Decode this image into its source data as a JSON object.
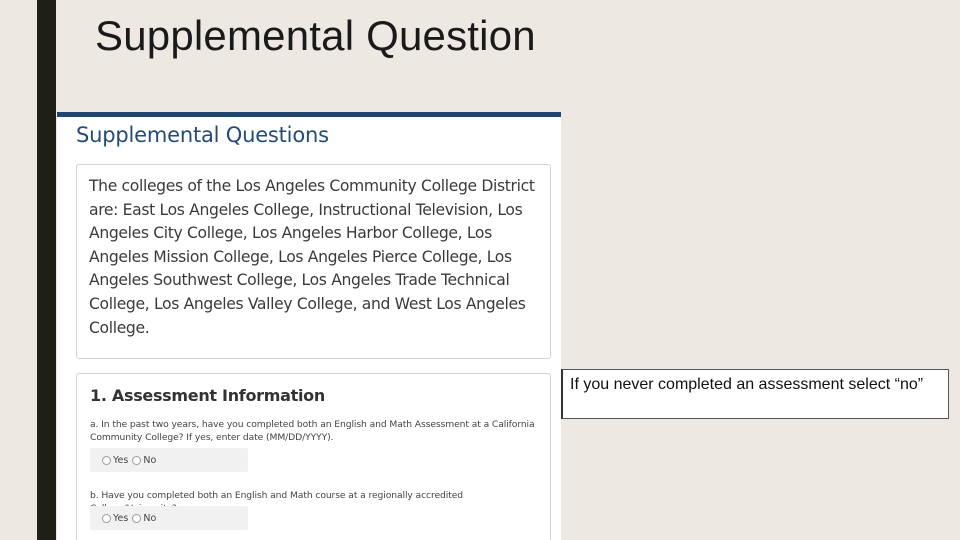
{
  "slide": {
    "title": "Supplemental Question"
  },
  "form": {
    "heading": "Supplemental Questions",
    "intro_text": "The colleges of the Los Angeles Community College District are: East Los Angeles College, Instructional Television, Los Angeles City College, Los Angeles Harbor College, Los Angeles Mission College, Los Angeles Pierce College, Los Angeles Southwest College, Los Angeles Trade Technical College, Los Angeles Valley College, and West Los Angeles College.",
    "section_title": "1. Assessment Information",
    "questions": [
      {
        "text": "a. In the past two years, have you completed both an English and Math Assessment at a California Community College? If yes, enter date (MM/DD/YYYY).",
        "options": [
          "Yes",
          "No"
        ]
      },
      {
        "text": "b. Have you completed both an English and Math course at a regionally accredited College/University?",
        "options": [
          "Yes",
          "No"
        ]
      }
    ]
  },
  "note": {
    "text": "If you never completed an assessment select “no”"
  },
  "colors": {
    "accent_bar": "#21456f",
    "heading": "#244b76",
    "left_bar": "#1f1f16",
    "background": "#ede9e2"
  }
}
